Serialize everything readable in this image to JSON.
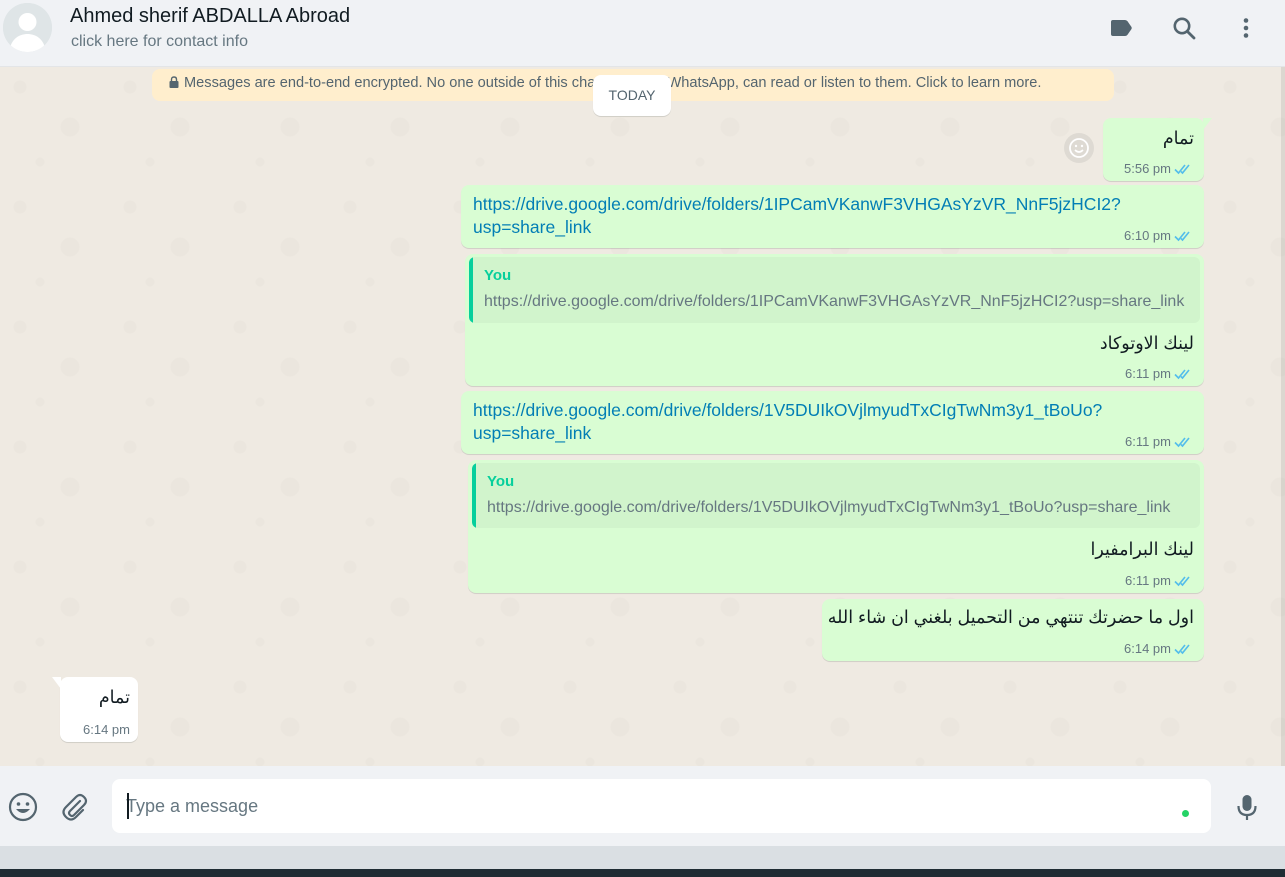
{
  "header": {
    "contact_name": "Ahmed sherif ABDALLA Abroad",
    "contact_sub": "click here for contact info"
  },
  "chat": {
    "encryption_notice": "Messages are end-to-end encrypted. No one outside of this chat, not even WhatsApp, can read or listen to them. Click to learn more.",
    "date_chip": "TODAY",
    "messages": [
      {
        "direction": "out",
        "text": "تمام",
        "time": "5:56 pm"
      },
      {
        "direction": "out",
        "link_line1": "https://drive.google.com/drive/folders/1IPCamVKanwF3VHGAsYzVR_NnF5jzHCI2?",
        "link_line2": "usp=share_link",
        "time": "6:10 pm"
      },
      {
        "direction": "out",
        "quote_author": "You",
        "quote_text": "https://drive.google.com/drive/folders/1IPCamVKanwF3VHGAsYzVR_NnF5jzHCI2?usp=share_link",
        "text": "لينك الاوتوكاد",
        "time": "6:11 pm"
      },
      {
        "direction": "out",
        "link_line1": "https://drive.google.com/drive/folders/1V5DUIkOVjlmyudTxCIgTwNm3y1_tBoUo?",
        "link_line2": "usp=share_link",
        "time": "6:11 pm"
      },
      {
        "direction": "out",
        "quote_author": "You",
        "quote_text": "https://drive.google.com/drive/folders/1V5DUIkOVjlmyudTxCIgTwNm3y1_tBoUo?usp=share_link",
        "text": "لينك البرامفيرا",
        "time": "6:11 pm"
      },
      {
        "direction": "out",
        "text": "اول ما حضرتك تنتهي من التحميل بلغني ان شاء الله",
        "time": "6:14 pm"
      },
      {
        "direction": "in",
        "text": "تمام",
        "time": "6:14 pm"
      }
    ]
  },
  "footer": {
    "input_placeholder": "Type a message"
  },
  "icons": {
    "header": [
      "label-icon",
      "search-icon",
      "menu-dots-icon"
    ],
    "footer": [
      "emoji-icon",
      "attach-icon",
      "microphone-icon"
    ]
  },
  "colors": {
    "outgoing_bubble": "#d9fdd3",
    "incoming_bubble": "#ffffff",
    "link": "#027eb5",
    "read_ticks": "#53bdeb",
    "quote_accent": "#06cf9c",
    "encryption_banner": "#ffeecd"
  }
}
